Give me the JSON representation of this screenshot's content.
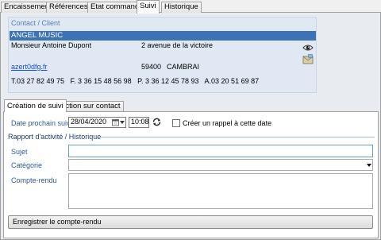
{
  "top_tabs": [
    "Encaissement",
    "Références",
    "Etat commande",
    "Suivi",
    "Historique"
  ],
  "active_top_tab": "Suivi",
  "contact": {
    "legend": "Contact / Client",
    "name": "ANGEL MUSIC",
    "person": "Monsieur Antoine Dupont",
    "address": "2 avenue de la victoire",
    "email": "azert0dfg.fr",
    "postal": "59400",
    "city": "CAMBRAI",
    "phones": "T.03 27 82 49 75   F. 3 36 15 48 56 98   P. 3 36 12 45 78 93   A.03 20 51 69 87"
  },
  "inner_tabs": [
    "Création de suivi",
    "Action sur contact"
  ],
  "active_inner_tab": "Création de suivi",
  "form": {
    "date_label": "Date prochain suivi",
    "date_value": "28/04/2020",
    "time_value": "10:08",
    "reminder_label": "Créer un rappel à cette date",
    "section_title": "Rapport d'activité / Historique",
    "subject_label": "Sujet",
    "subject_value": "",
    "category_label": "Catégorie",
    "category_value": "",
    "report_label": "Compte-rendu",
    "report_value": "",
    "save_label": "Enregistrer le compte-rendu"
  },
  "colors": {
    "contact_bar": "#3d72b4",
    "label_blue": "#2e5d9e",
    "panel_bg": "#e8ecf1"
  },
  "icons": [
    "eye-icon",
    "envelope-icon",
    "calendar-icon",
    "refresh-icon",
    "dropdown-arrow-icon"
  ]
}
